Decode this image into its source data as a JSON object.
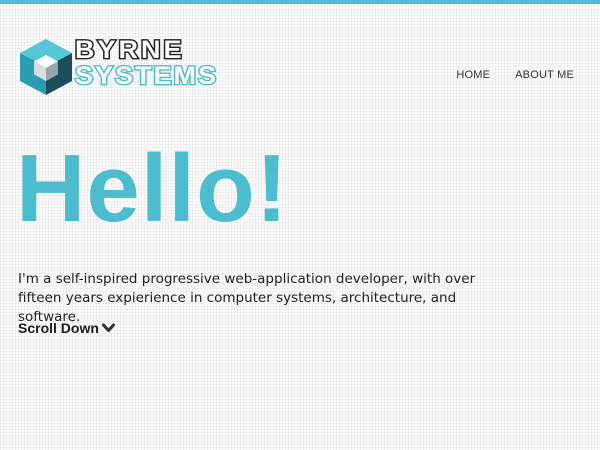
{
  "brand": {
    "line1": "BYRNE",
    "line2": "SYSTEMS",
    "accent_color": "#4bbdcf",
    "dark_color": "#1e1e1e"
  },
  "nav": {
    "items": [
      {
        "label": "HOME"
      },
      {
        "label": "ABOUT ME"
      }
    ]
  },
  "hero": {
    "heading": "Hello!",
    "intro": "I'm a self-inspired progressive web-application developer, with over fifteen years expierience in computer systems, architecture, and software.",
    "scroll_label": "Scroll Down",
    "scroll_icon": "chevron-down-icon"
  }
}
